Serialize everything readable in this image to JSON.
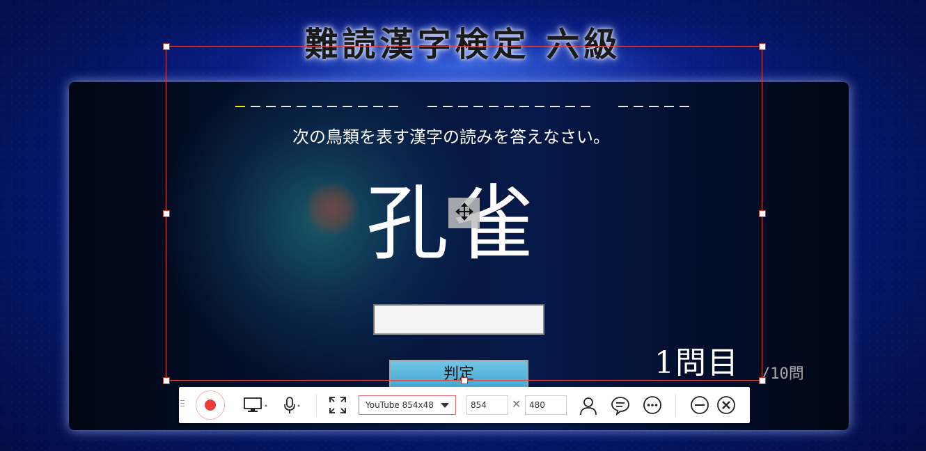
{
  "game": {
    "title": "難読漢字検定 六級",
    "question": "次の鳥類を表す漢字の読みを答えなさい。",
    "kanji": "孔雀",
    "answer_value": "",
    "judge_label": "判定",
    "counter": "1問目",
    "total": "/10問"
  },
  "recorder_toolbar": {
    "preset": "YouTube 854x48",
    "width_value": "854",
    "height_value": "480",
    "times_symbol": "✕",
    "icons": [
      "record-icon",
      "monitor-icon",
      "microphone-icon",
      "fullscreen-icon",
      "webcam-user-icon",
      "comment-icon",
      "more-icon",
      "minimize-icon",
      "close-icon"
    ],
    "accent_color": "#ec3b3b"
  },
  "selection": {
    "border_color": "#e24a4a"
  }
}
